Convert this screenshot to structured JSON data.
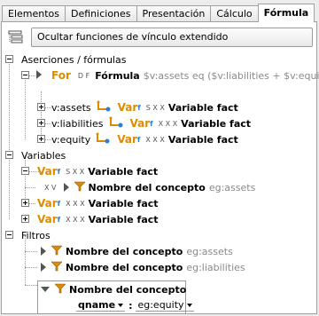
{
  "tabs": [
    {
      "label": "Elementos"
    },
    {
      "label": "Definiciones"
    },
    {
      "label": "Presentación"
    },
    {
      "label": "Cálculo"
    },
    {
      "label": "Fórmula"
    }
  ],
  "toolbar": {
    "toggle_label": "Ocultar funciones de vínculo extendido"
  },
  "tree": {
    "assertions_label": "Aserciones / fórmulas",
    "formula": {
      "keyword": "For",
      "flags": "D F",
      "label": "Fórmula",
      "expr": "$v:assets eq ($v:liabilities + $v:equity)"
    },
    "formula_vars": [
      {
        "name": "v:assets",
        "keyword": "Var",
        "sub": "f",
        "flags": "S X X",
        "label": "Variable fact"
      },
      {
        "name": "v:liabilities",
        "keyword": "Var",
        "sub": "f",
        "flags": "X X X",
        "label": "Variable fact"
      },
      {
        "name": "v:equity",
        "keyword": "Var",
        "sub": "f",
        "flags": "X X X",
        "label": "Variable fact"
      }
    ],
    "variables_label": "Variables",
    "variables": [
      {
        "keyword": "Var",
        "sub": "f",
        "flags": "S X X",
        "label": "Variable fact",
        "child": {
          "flags": "X V",
          "label": "Nombre del concepto",
          "value": "eg:assets"
        }
      },
      {
        "keyword": "Var",
        "sub": "f",
        "flags": "X X X",
        "label": "Variable fact"
      },
      {
        "keyword": "Var",
        "sub": "f",
        "flags": "X X X",
        "label": "Variable fact"
      }
    ],
    "filters_label": "Filtros",
    "filters": [
      {
        "label": "Nombre del concepto",
        "value": "eg:assets"
      },
      {
        "label": "Nombre del concepto",
        "value": "eg:liabilities"
      },
      {
        "label": "Nombre del concepto",
        "qname_label": "qname",
        "qname_value": "eg:equity"
      }
    ]
  }
}
